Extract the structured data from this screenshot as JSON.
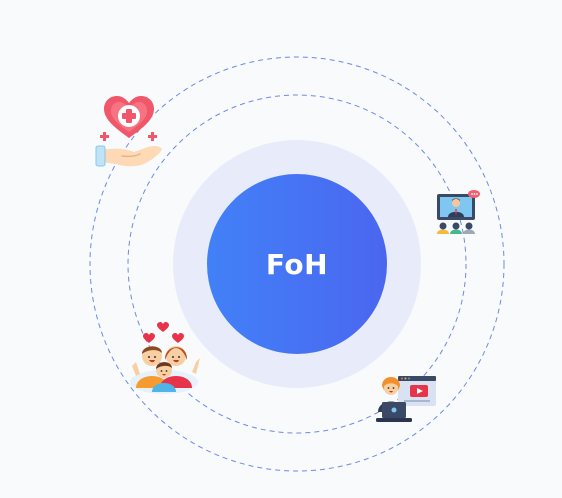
{
  "diagram": {
    "center_label": "FoH",
    "icons": [
      {
        "name": "healthcare-hand-heart-icon"
      },
      {
        "name": "online-meeting-presenter-icon"
      },
      {
        "name": "happy-family-hearts-icon"
      },
      {
        "name": "video-content-creator-icon"
      }
    ]
  },
  "colors": {
    "background": "#f9fafc",
    "halo": "#e8ecfa",
    "core_gradient_start": "#4281f7",
    "core_gradient_end": "#4a66f0",
    "orbit_stroke": "#5b7ce0",
    "center_text": "#ffffff"
  }
}
